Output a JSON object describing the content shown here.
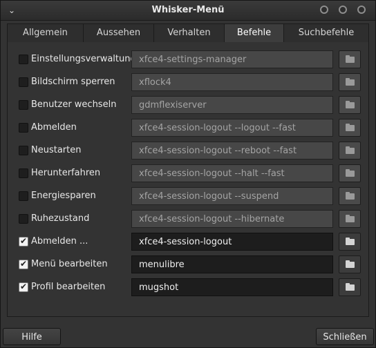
{
  "window": {
    "title": "Whisker-Menü"
  },
  "tabs": [
    {
      "label": "Allgemein",
      "active": false
    },
    {
      "label": "Aussehen",
      "active": false
    },
    {
      "label": "Verhalten",
      "active": false
    },
    {
      "label": "Befehle",
      "active": true
    },
    {
      "label": "Suchbefehle",
      "active": false
    }
  ],
  "commands": [
    {
      "label": "Einstellungsverwaltung",
      "checked": false,
      "command": "xfce4-settings-manager"
    },
    {
      "label": "Bildschirm sperren",
      "checked": false,
      "command": "xflock4"
    },
    {
      "label": "Benutzer wechseln",
      "checked": false,
      "command": "gdmflexiserver"
    },
    {
      "label": "Abmelden",
      "checked": false,
      "command": "xfce4-session-logout --logout --fast"
    },
    {
      "label": "Neustarten",
      "checked": false,
      "command": "xfce4-session-logout --reboot --fast"
    },
    {
      "label": "Herunterfahren",
      "checked": false,
      "command": "xfce4-session-logout --halt --fast"
    },
    {
      "label": "Energiesparen",
      "checked": false,
      "command": "xfce4-session-logout --suspend"
    },
    {
      "label": "Ruhezustand",
      "checked": false,
      "command": "xfce4-session-logout --hibernate"
    },
    {
      "label": "Abmelden ...",
      "checked": true,
      "command": "xfce4-session-logout"
    },
    {
      "label": "Menü bearbeiten",
      "checked": true,
      "command": "menulibre"
    },
    {
      "label": "Profil bearbeiten",
      "checked": true,
      "command": "mugshot"
    }
  ],
  "buttons": {
    "help": "Hilfe",
    "close": "Schließen"
  },
  "icons": {
    "window_menu": "chevron-down-icon",
    "browse": "folder-icon"
  }
}
